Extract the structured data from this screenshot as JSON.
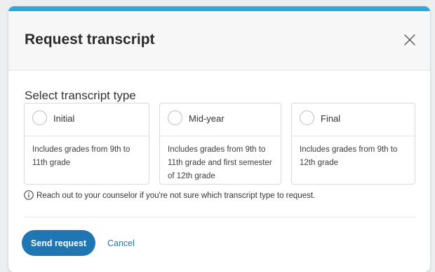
{
  "modal": {
    "title": "Request transcript",
    "close_icon": "close-x-icon"
  },
  "section": {
    "title": "Select transcript type"
  },
  "options": [
    {
      "label": "Initial",
      "description": "Includes grades from 9th to 11th grade",
      "selected": false
    },
    {
      "label": "Mid-year",
      "description": "Includes grades from 9th to 11th grade and first semester of 12th grade",
      "selected": false
    },
    {
      "label": "Final",
      "description": "Includes grades from 9th to 12th grade",
      "selected": false
    }
  ],
  "note": {
    "icon": "info-icon",
    "text": "Reach out to your counselor if you're not sure which transcript type to request."
  },
  "actions": {
    "send_label": "Send request",
    "cancel_label": "Cancel"
  },
  "colors": {
    "accent_bar": "#29a9e0",
    "primary_button": "#1f76b2",
    "link": "#1f76b2",
    "header_bg": "#f7f7f7"
  }
}
